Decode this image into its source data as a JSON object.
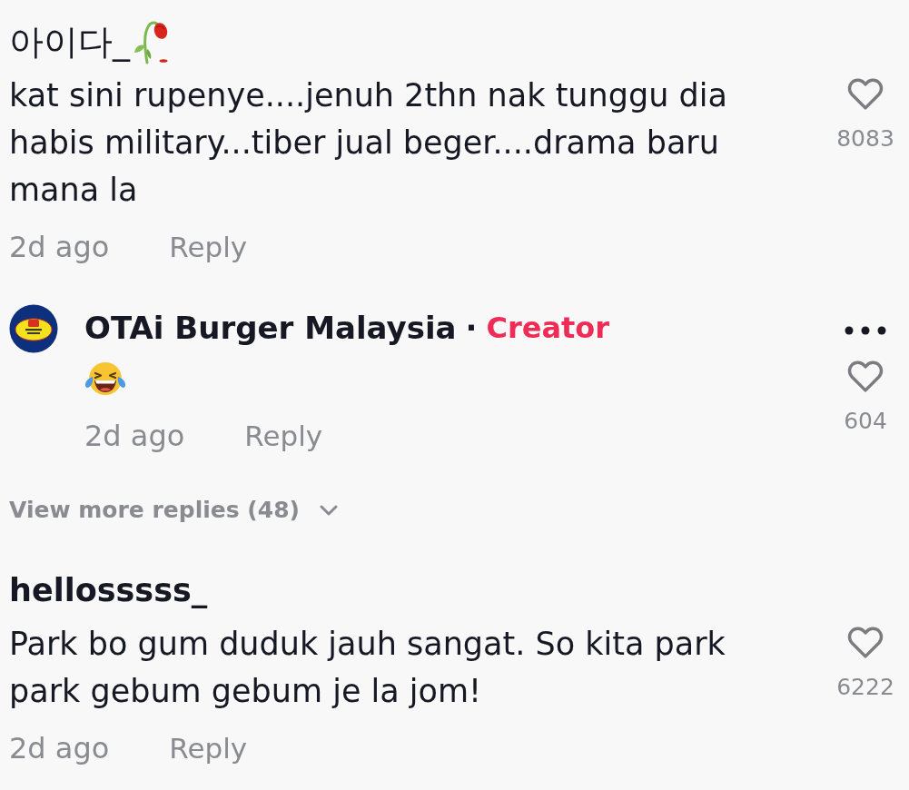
{
  "comments": [
    {
      "author": "아이다_",
      "author_emoji": true,
      "body": "kat sini rupenye....jenuh 2thn nak tunggu dia habis military...tiber jual beger....drama baru mana la",
      "time": "2d ago",
      "reply_label": "Reply",
      "liked": false,
      "likes": "8083",
      "replies": [
        {
          "author": "OTAi Burger Malaysia",
          "separator": "·",
          "badge": "Creator",
          "emoji_body": true,
          "time": "2d ago",
          "reply_label": "Reply",
          "liked": false,
          "likes": "604"
        }
      ],
      "view_more": "View more replies (48)"
    },
    {
      "author": "hellosssss_",
      "author_emoji": false,
      "body": "Park bo gum duduk jauh sangat. So kita park park gebum gebum je la jom!",
      "time": "2d ago",
      "reply_label": "Reply",
      "liked": false,
      "likes": "6222"
    }
  ]
}
